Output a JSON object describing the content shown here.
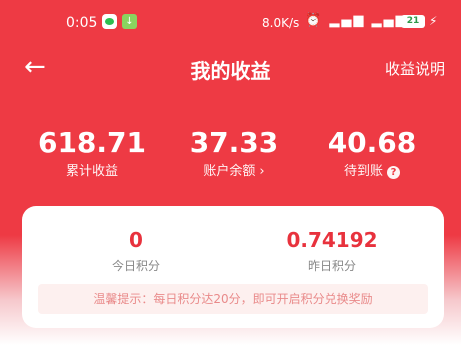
{
  "status_bar": {
    "time": "0:05",
    "network_speed": "8.0K/s",
    "indicators": "⏰ ▂▄▆ ▂▄▆ ◠",
    "battery": "21"
  },
  "header": {
    "back_icon": "←",
    "title": "我的收益",
    "help_link": "收益说明"
  },
  "stats": [
    {
      "value": "618.71",
      "label": "累计收益"
    },
    {
      "value": "37.33",
      "label": "账户余额",
      "chevron": "›"
    },
    {
      "value": "40.68",
      "label": "待到账",
      "help": "?"
    }
  ],
  "points_card": {
    "today": {
      "value": "0",
      "label": "今日积分"
    },
    "yesterday": {
      "value": "0.74192",
      "label": "昨日积分"
    },
    "tip": "温馨提示：每日积分达20分，即可开启积分兑换奖励"
  },
  "colors": {
    "primary": "#ee3a44",
    "points_value": "#e8323d",
    "tip_bg": "#fdf0ef",
    "tip_text": "#e98a8a"
  },
  "icons": [
    "wechat-icon",
    "download-icon",
    "alarm-icon",
    "signal-icon",
    "wifi-icon",
    "battery-icon",
    "charging-icon",
    "back-arrow-icon",
    "chevron-right-icon",
    "help-circle-icon"
  ]
}
